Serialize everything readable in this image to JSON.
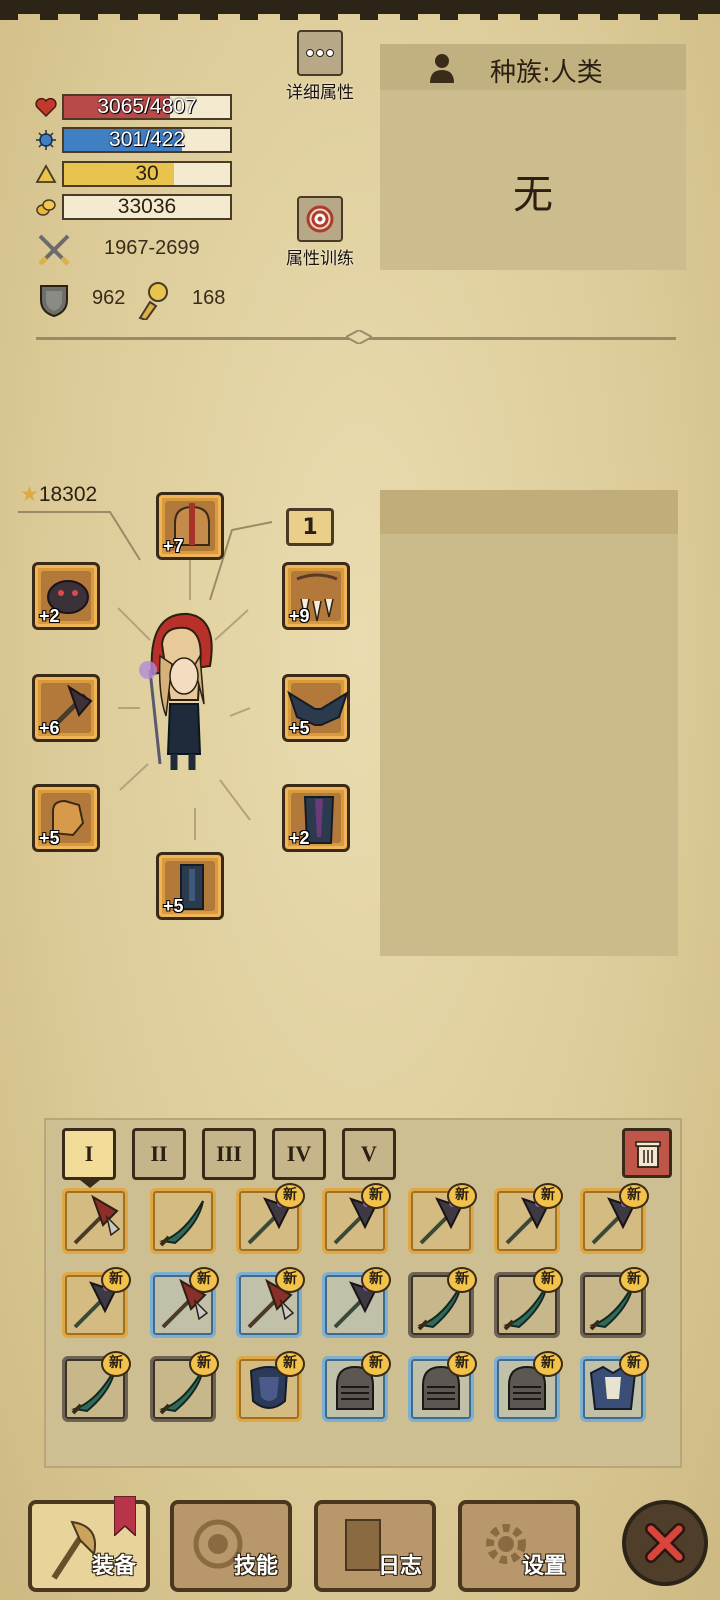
{
  "stats": {
    "hp": {
      "text": "3065/4807",
      "fill": 0.64,
      "color": "#b84a4a"
    },
    "mp": {
      "text": "301/422",
      "fill": 0.71,
      "color": "#3f7fc4"
    },
    "level": {
      "text": "30",
      "fill": 0.66,
      "color": "#e8c44e"
    },
    "gold": {
      "text": "33036"
    },
    "attack": "1967-2699",
    "defense": "962",
    "other": "168"
  },
  "buttons": {
    "detail_attributes": "详细属性",
    "attribute_training": "属性训练"
  },
  "race": {
    "label": "种族:人类",
    "value": "无"
  },
  "equipment": {
    "score": "18302",
    "badge": "1",
    "slots": [
      {
        "name": "helmet",
        "level": "+7"
      },
      {
        "name": "shoulder",
        "level": "+2"
      },
      {
        "name": "weapon",
        "level": "+6"
      },
      {
        "name": "gloves",
        "level": "+5"
      },
      {
        "name": "boots",
        "level": "+5"
      },
      {
        "name": "necklace",
        "level": "+9"
      },
      {
        "name": "cape",
        "level": "+5"
      },
      {
        "name": "legs",
        "level": "+2"
      }
    ]
  },
  "inventory": {
    "tabs": [
      "I",
      "II",
      "III",
      "IV",
      "V"
    ],
    "active_tab": "I",
    "new_tag": "新"
  },
  "nav": {
    "equip": "装备",
    "skills": "技能",
    "log": "日志",
    "settings": "设置"
  }
}
